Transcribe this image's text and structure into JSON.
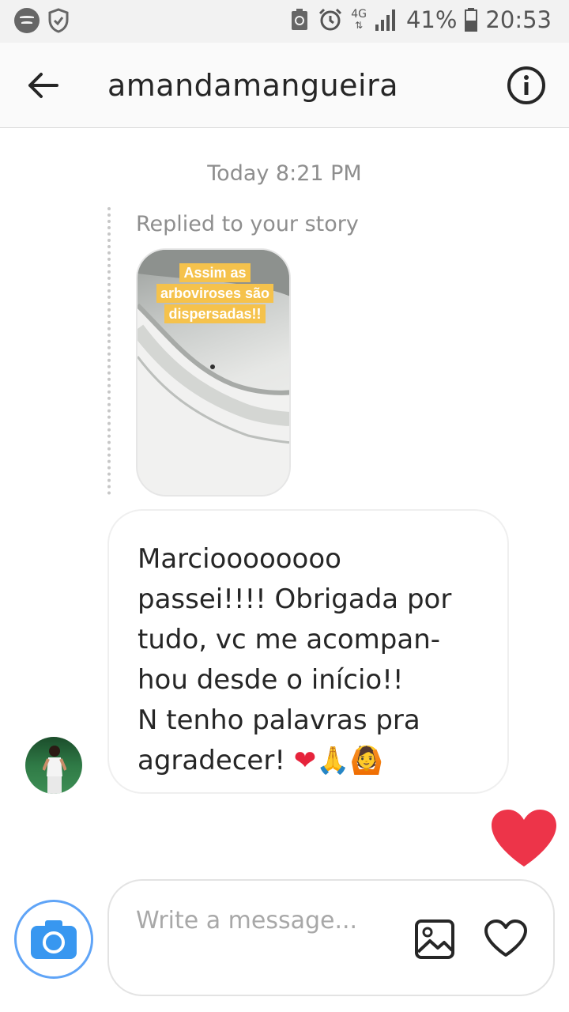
{
  "status_bar": {
    "left_icons": [
      "spotify-icon",
      "shield-check-icon"
    ],
    "right_icons": [
      "battery-saver-icon",
      "alarm-icon",
      "signal-icon",
      "battery-icon"
    ],
    "network": "4G",
    "battery_percent": "41%",
    "time": "20:53"
  },
  "header": {
    "title": "amandamangueira",
    "back_icon": "back-arrow-icon",
    "info_icon": "info-icon"
  },
  "conversation": {
    "timestamp": "Today 8:21 PM",
    "reply_label": "Replied to your story",
    "story_caption": "Assim as arboviroses são dispersadas!!",
    "message_text": "Marcioooooooo\npassei!!!! Obrigada por\ntudo, vc me acompan-\nhou desde o início!!\nN tenho palavras pra\nagradecer! ",
    "message_emojis": "❤🙏🙆",
    "like_icon": "heart-filled-icon",
    "like_color": "#ed3449"
  },
  "composer": {
    "placeholder": "Write a message...",
    "camera_icon": "camera-icon",
    "gallery_icon": "gallery-icon",
    "heart_icon": "heart-outline-icon",
    "camera_color": "#3897f0"
  }
}
